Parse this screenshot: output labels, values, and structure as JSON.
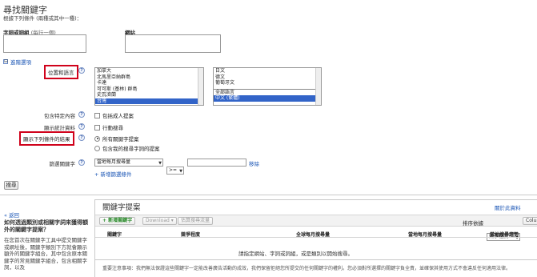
{
  "page": {
    "title": "尋找關鍵字",
    "subtitle": "根據下列條件 (兩種或其中一種)："
  },
  "search": {
    "words_label": "字詞或詞組",
    "words_hint": "(每行一個)",
    "website_label": "網站"
  },
  "advanced": {
    "toggle": "⊟",
    "label": "進階選項",
    "location_lang_label": "位置和語言",
    "locations": [
      "加拿大",
      "北馬里亞納群島",
      "卡達",
      "可可斯 (基林) 群島",
      "史瓦濟蘭",
      "台灣"
    ],
    "selected_location": "台灣",
    "languages": [
      "日文",
      "德文",
      "葡萄牙文",
      "",
      "全部語言",
      "中文 (繁體)"
    ],
    "selected_language": "中文 (繁體)",
    "content_label": "包含特定內容",
    "adult_checkbox": "包括成人提案",
    "stats_label": "顯示統計資料",
    "mobile_checkbox": "行動搜尋",
    "filter_label": "顯示下列條件的結果",
    "radio_all": "所有關鍵字提案",
    "radio_mine": "包含我的搜尋字詞的提案",
    "filter_kw_label": "篩選關鍵字",
    "filter_metric": "當地每月搜尋量",
    "filter_op": ">=",
    "remove_link": "移除",
    "add_filter_link": "+ 新增篩選條件",
    "help_glyph": "?"
  },
  "search_button": "搜尋",
  "sidebar": {
    "back_link": "« 返回",
    "heading": "如何透過類別或相關字詞來獲得額外的關鍵字提案？",
    "body": "在您首次在關鍵字工具中提交關鍵字或網址後，關鍵字類別下方就會顯示額外的關鍵字組合，其中包含原本關鍵字的常見關鍵字組合，包含相關字詞，以及"
  },
  "results": {
    "panel_title": "關鍵字提案",
    "about_link": "關於此資料",
    "add_keyword_btn": "+ 新增關鍵字",
    "download_btn": "Download",
    "download_arrow": "▾",
    "search_traffic_btn": "估算搜尋流量",
    "sort_label": "排序依據",
    "sort_value": "競爭程度",
    "columns_btn": "Colum",
    "columns": [
      "關鍵字",
      "競爭程度",
      "全球每月搜尋量",
      "當地每月搜尋量",
      "當地搜尋趨勢"
    ],
    "empty_message": "請指定網站、字詞或詞組，或是類別以開始搜尋。",
    "footer_note": "重要注意事項：我們無法保證這些關鍵字一定能改善廣告活動的成效，我們保留拒絕您所提交的任何關鍵字的權利。您必須對所選擇的關鍵字負全責，並確保其使用方式不會違反任何適用法律。"
  }
}
